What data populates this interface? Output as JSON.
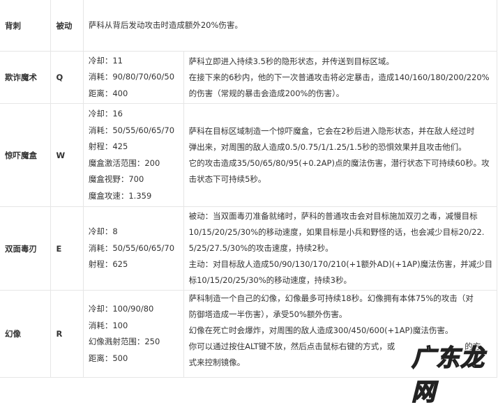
{
  "skills": [
    {
      "name": "背刺",
      "key": "被动",
      "desc": [
        "萨科从背后发动攻击时造成额外20%伤害。"
      ]
    },
    {
      "name": "欺诈魔术",
      "key": "Q",
      "stats": [
        "冷却：11",
        "消耗：90/80/70/60/50",
        "距离：400"
      ],
      "desc": [
        "萨科立即进入持续3.5秒的隐形状态，并传送到目标区域。",
        "在接下来的6秒内，他的下一次普通攻击将必定暴击，造成140/160/180/200/220%",
        "的伤害（常规的暴击会造成200%的伤害）。"
      ]
    },
    {
      "name": "惊吓魔盒",
      "key": "W",
      "stats": [
        "冷却：16",
        "消耗：50/55/60/65/70",
        "射程：425",
        "魔盒激活范围：200",
        "魔盒视野：700",
        "魔盒攻速：1.359"
      ],
      "desc": [
        "萨科在目标区域制造一个惊吓魔盒，它会在2秒后进入隐形状态，并在敌人经过时",
        "弹出来，对周围的敌人造成0.5/0.75/1/1.25/1.5秒的恐惧效果并且攻击他们。",
        "它的攻击造成35/50/65/80/95(+0.2AP)点的魔法伤害，潜行状态下可持续60秒。攻",
        "击状态下可持续5秒。"
      ]
    },
    {
      "name": "双面毒刃",
      "key": "E",
      "stats": [
        "冷却：8",
        "消耗：50/55/60/65/70",
        "射程：625"
      ],
      "desc": [
        "被动：当双面毒刃准备就绪时，萨科的普通攻击会对目标施加双刃之毒，减慢目标",
        "10/15/20/25/30%的移动速度，如果目标是小兵和野怪的话，也会减少目标20/22.",
        "5/25/27.5/30%的攻击速度，持续2秒。",
        "主动：对目标敌人造成50/90/130/170/210(+1额外AD)(+1AP)魔法伤害，并减少目",
        "标10/15/20/25/30%的移动速度，持续3秒。"
      ]
    },
    {
      "name": "幻像",
      "key": "R",
      "stats": [
        "冷却：100/90/80",
        "消耗：100",
        "幻像溅射范围：250",
        "距离：500"
      ],
      "desc": [
        "萨科制造一个自己的幻像，幻像最多可持续18秒。幻像拥有本体75%的攻击（对",
        "防御塔造成一半伤害），承受50%额外伤害。",
        "幻像在死亡时会爆炸，对周围的敌人造成300/450/600(+1AP)魔法伤害。"
      ],
      "desc_last_a": "你可以通过按住ALT键不放，然后点击鼠标右键的方式，或",
      "desc_last_b": "的方",
      "desc_end": "式来控制镜像。"
    }
  ],
  "watermark": "广东龙网"
}
